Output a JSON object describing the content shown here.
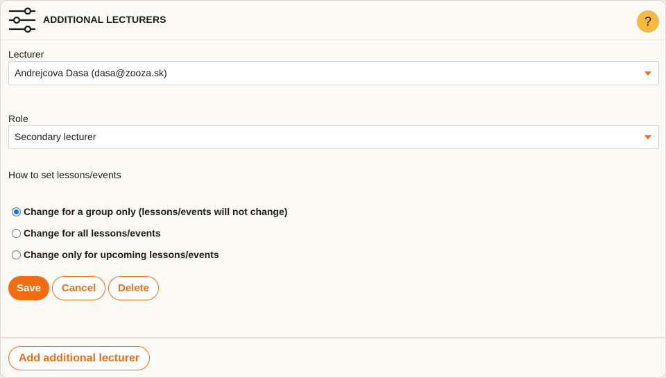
{
  "header": {
    "title": "ADDITIONAL LECTURERS",
    "help_label": "?"
  },
  "form": {
    "lecturer_label": "Lecturer",
    "lecturer_value": "Andrejcova Dasa (dasa@zooza.sk)",
    "role_label": "Role",
    "role_value": "Secondary lecturer",
    "lessons_label": "How to set lessons/events",
    "options": [
      {
        "label": "Change for a group only (lessons/events will not change)",
        "checked": true
      },
      {
        "label": "Change for all lessons/events",
        "checked": false
      },
      {
        "label": "Change only for upcoming lessons/events",
        "checked": false
      }
    ]
  },
  "actions": {
    "save_label": "Save",
    "cancel_label": "Cancel",
    "delete_label": "Delete"
  },
  "footer": {
    "add_label": "Add additional lecturer"
  },
  "colors": {
    "accent": "#f36c12",
    "help_badge": "#f4b942",
    "radio_selected": "#1a6fd4"
  }
}
